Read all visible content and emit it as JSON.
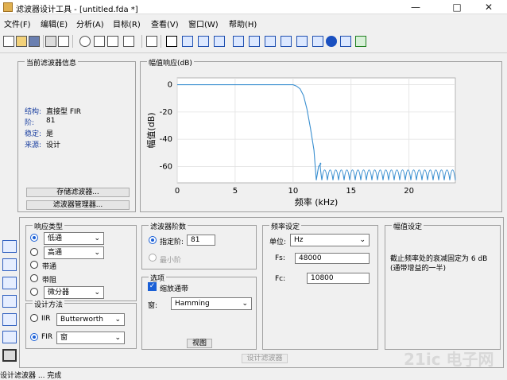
{
  "window": {
    "title": "滤波器设计工具 - [untitled.fda *]",
    "controls": [
      "—",
      "□",
      "✕"
    ]
  },
  "menu": [
    "文件(F)",
    "编辑(E)",
    "分析(A)",
    "目标(R)",
    "查看(V)",
    "窗口(W)",
    "帮助(H)"
  ],
  "filter_info": {
    "group_label": "当前滤波器信息",
    "rows": [
      {
        "key": "结构:",
        "value": "直接型 FIR"
      },
      {
        "key": "阶:",
        "value": "81"
      },
      {
        "key": "稳定:",
        "value": "是"
      },
      {
        "key": "来源:",
        "value": "设计"
      }
    ],
    "store_button": "存储滤波器...",
    "manager_button": "滤波器管理器..."
  },
  "plot": {
    "group_label": "幅值响应(dB)",
    "chart_data": {
      "type": "line",
      "xlabel": "频率 (kHz)",
      "ylabel": "幅值(dB)",
      "xlim": [
        0,
        24
      ],
      "ylim": [
        -72,
        5
      ],
      "xticks": [
        0,
        5,
        10,
        15,
        20
      ],
      "yticks": [
        0,
        -20,
        -40,
        -60
      ],
      "grid": true,
      "color": "#3a8fd0",
      "series": [
        {
          "x": [
            0,
            10.0,
            10.3,
            10.6,
            10.9,
            11.2,
            11.5,
            11.8,
            12.0,
            12.2,
            12.4
          ],
          "y": [
            0,
            0,
            -1,
            -3,
            -8,
            -18,
            -32,
            -48,
            -70,
            -60,
            -58
          ]
        }
      ],
      "stopband_ripple": {
        "x_start": 12.0,
        "x_end": 24.0,
        "lobes": 25,
        "peak_db": -58,
        "null_db": -70
      }
    }
  },
  "response_type": {
    "group_label": "响应类型",
    "options": [
      {
        "label": "低通",
        "selected": true,
        "dropdown": true
      },
      {
        "label": "高通",
        "selected": false,
        "dropdown": true
      },
      {
        "label": "带通",
        "selected": false,
        "dropdown": false
      },
      {
        "label": "带阻",
        "selected": false,
        "dropdown": false
      },
      {
        "label": "微分器",
        "selected": false,
        "dropdown": true
      }
    ]
  },
  "design_method": {
    "group_label": "设计方法",
    "iir_label": "IIR",
    "iir_value": "Butterworth",
    "fir_label": "FIR",
    "fir_value": "窗"
  },
  "order": {
    "group_label": "滤波器阶数",
    "specify_label": "指定阶:",
    "specify_value": "81",
    "minimum_label": "最小阶"
  },
  "options": {
    "group_label": "选项",
    "scale_label": "缩放通带",
    "window_label": "窗:",
    "window_value": "Hamming",
    "view_button": "视图"
  },
  "frequency": {
    "group_label": "频率设定",
    "units_label": "单位:",
    "units_value": "Hz",
    "fs_label": "Fs:",
    "fs_value": "48000",
    "fc_label": "Fc:",
    "fc_value": "10800"
  },
  "magnitude": {
    "group_label": "幅值设定",
    "description": "截止频率处的衰减固定为 6 dB\n(通带增益的一半)"
  },
  "design_button": "设计滤波器",
  "status": "设计滤波器 ... 完成",
  "watermark": "21ic 电子网"
}
